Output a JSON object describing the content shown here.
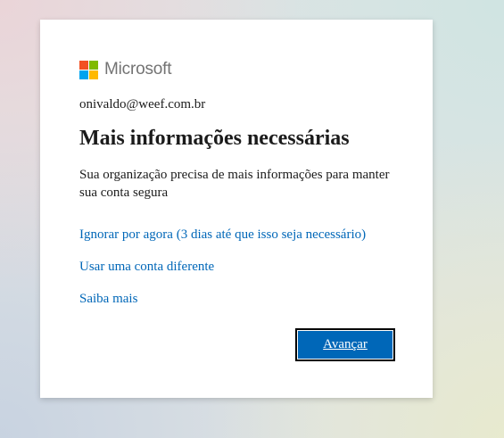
{
  "brand": {
    "name": "Microsoft",
    "logo_colors": [
      "#f25022",
      "#7fba00",
      "#00a4ef",
      "#ffb900"
    ],
    "accent": "#0067b8"
  },
  "identity": {
    "email": "onivaldo@weef.com.br"
  },
  "main": {
    "title": "Mais informações necessárias",
    "description": "Sua organização precisa de mais informações para manter sua conta segura"
  },
  "links": {
    "skip": "Ignorar por agora (3 dias até que isso seja necessário)",
    "use_other_account": "Usar uma conta diferente",
    "learn_more": "Saiba mais"
  },
  "actions": {
    "next_label": "Avançar"
  }
}
